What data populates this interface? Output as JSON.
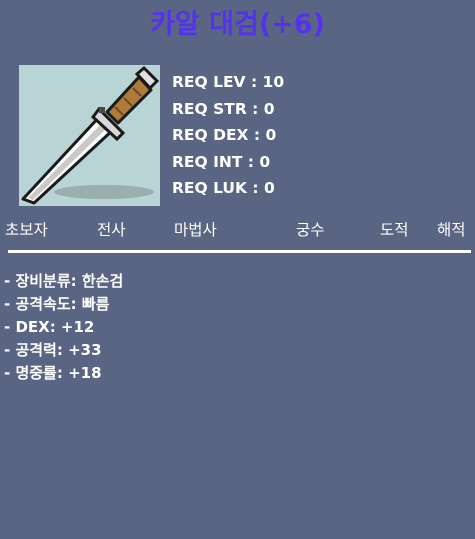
{
  "item": {
    "name": "카알 대검(+6)",
    "icon": "dagger-sword-icon"
  },
  "requirements": [
    "REQ LEV : 10",
    "REQ STR : 0",
    "REQ DEX : 0",
    "REQ INT : 0",
    "REQ LUK : 0"
  ],
  "jobs": [
    "초보자",
    "전사",
    "마법사",
    "궁수",
    "도적",
    "해적"
  ],
  "stats": [
    "- 장비분류: 한손검",
    "- 공격속도: 빠름",
    "- DEX: +12",
    "- 공격력: +33",
    "- 명중률: +18"
  ],
  "colors": {
    "background": "#5a6583",
    "title": "#5533ee",
    "icon_background": "#b8d4d4"
  }
}
